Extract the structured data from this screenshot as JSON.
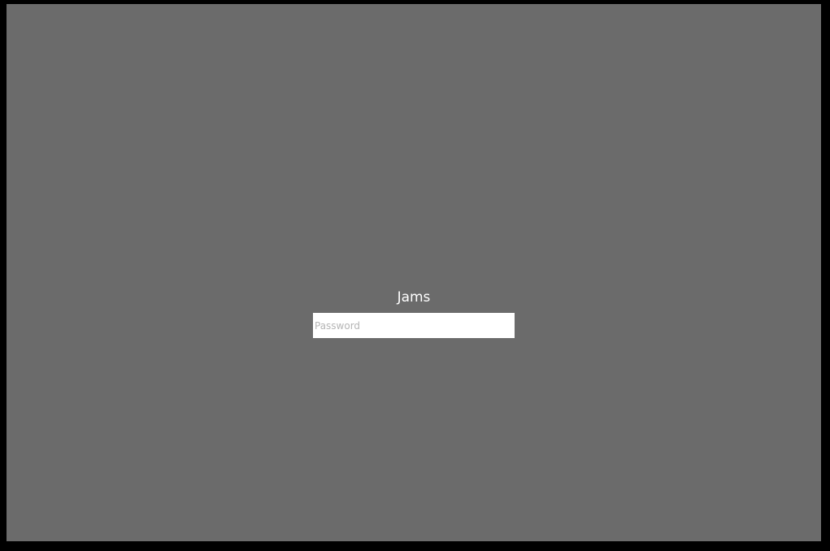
{
  "lock_screen": {
    "username": "Jams",
    "password_placeholder": "Password",
    "password_value": ""
  },
  "colors": {
    "frame": "#000000",
    "background": "#6b6b6b",
    "text": "#ffffff",
    "input_background": "#ffffff",
    "placeholder": "#b5b5b5"
  }
}
